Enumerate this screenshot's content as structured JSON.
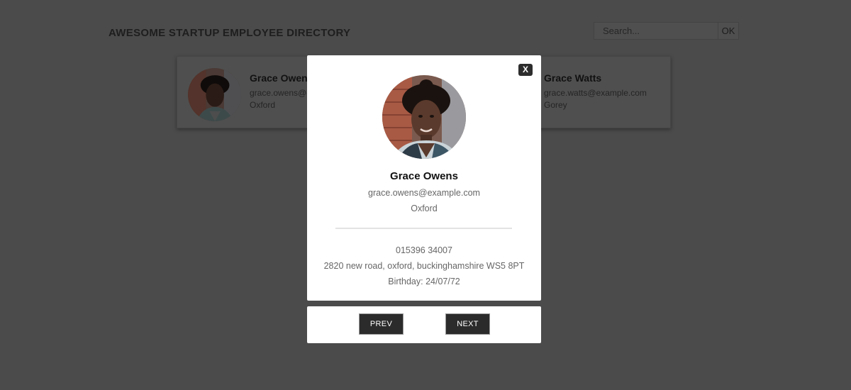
{
  "header": {
    "title": "AWESOME STARTUP EMPLOYEE DIRECTORY"
  },
  "search": {
    "placeholder": "Search...",
    "button_label": "OK"
  },
  "cards": [
    {
      "name": "Grace Owens",
      "email": "grace.owens@example.com",
      "city": "Oxford"
    },
    {
      "name": "Grace Watts",
      "email": "grace.watts@example.com",
      "city": "Gorey"
    }
  ],
  "modal": {
    "close_label": "X",
    "name": "Grace Owens",
    "email": "grace.owens@example.com",
    "city": "Oxford",
    "phone": "015396 34007",
    "address": "2820 new road, oxford, buckinghamshire WS5 8PT",
    "birthday": "Birthday: 24/07/72",
    "prev_label": "PREV",
    "next_label": "NEXT"
  },
  "colors": {
    "overlay_background": "#4b4b4b",
    "modal_background": "#ffffff",
    "button_dark": "#2b2b2b"
  }
}
